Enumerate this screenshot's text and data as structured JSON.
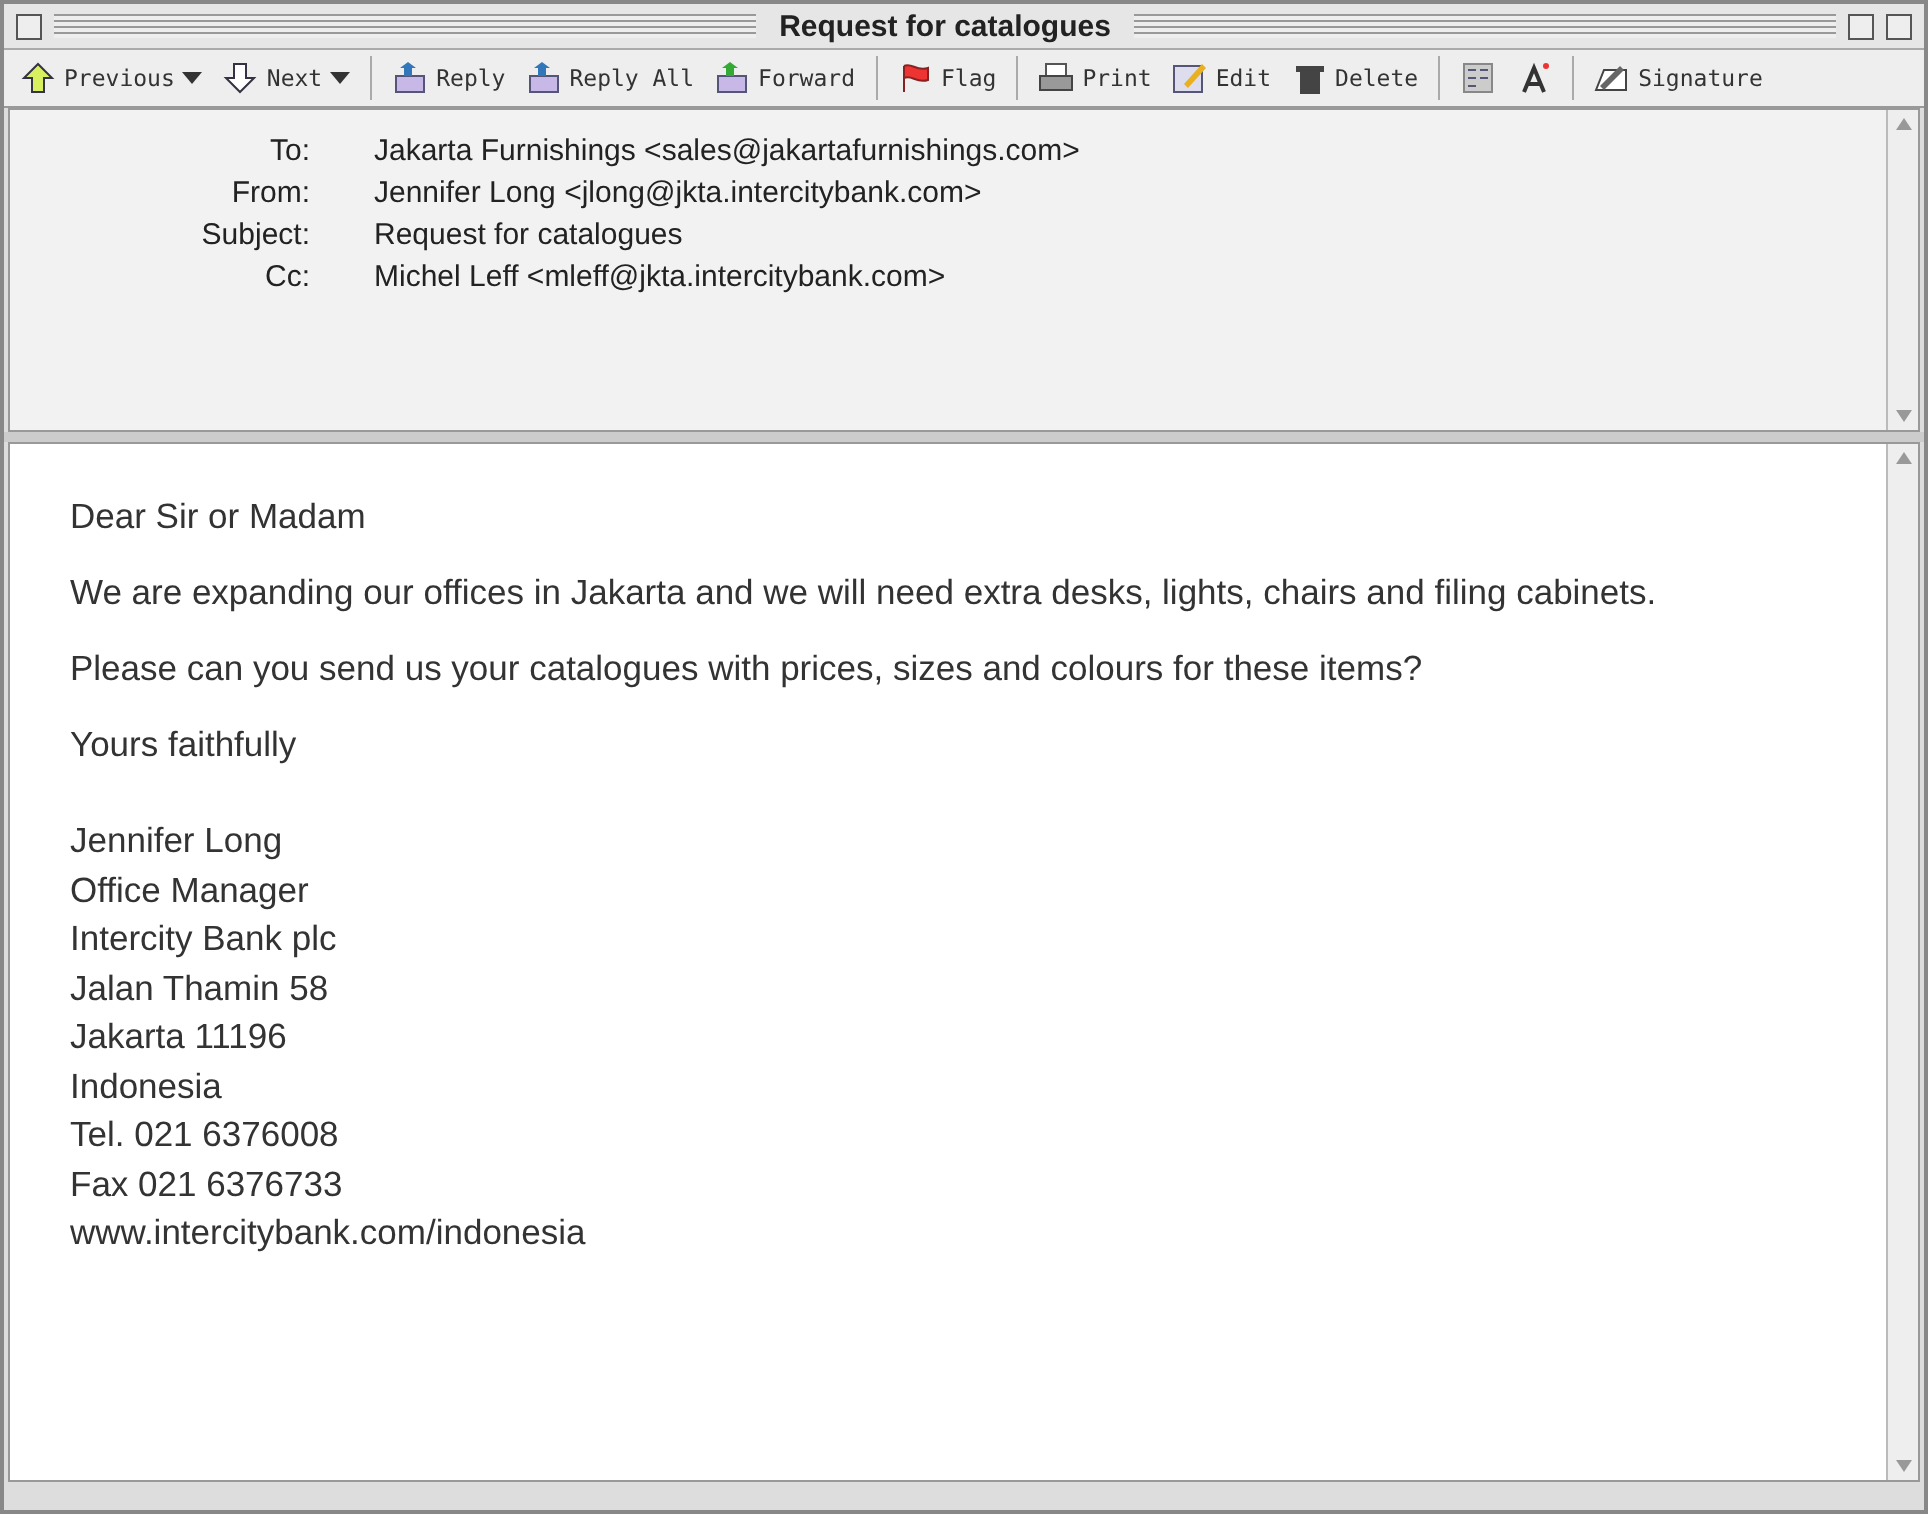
{
  "window": {
    "title": "Request for catalogues"
  },
  "toolbar": [
    [
      {
        "label": "Previous",
        "menu": true
      },
      {
        "label": "Next",
        "menu": true
      }
    ],
    [
      {
        "label": "Reply",
        "menu": false
      },
      {
        "label": "Reply All",
        "menu": false
      },
      {
        "label": "Forward",
        "menu": false
      }
    ],
    [
      {
        "label": "Flag",
        "menu": false
      }
    ],
    [
      {
        "label": "Print",
        "menu": false
      },
      {
        "label": "Edit",
        "menu": false
      },
      {
        "label": "Delete",
        "menu": false
      }
    ],
    [
      {
        "menu": false
      },
      {
        "menu": false
      }
    ],
    [
      {
        "label": "Signature",
        "menu": false
      }
    ]
  ],
  "header": [
    {
      "label": "To:",
      "value": "Jakarta Furnishings <sales@jakartafurnishings.com>"
    },
    {
      "label": "From:",
      "value": "Jennifer Long <jlong@jkta.intercitybank.com>"
    },
    {
      "label": "Subject:",
      "value": "Request for catalogues"
    },
    {
      "label": "Cc:",
      "value": "Michel Leff <mleff@jkta.intercitybank.com>"
    }
  ],
  "body": {
    "paragraphs": [
      "Dear Sir or Madam",
      "We are expanding our offices in Jakarta and we will need extra desks, lights, chairs and filing cabinets.",
      "Please can you send us your catalogues with prices, sizes and colours for these items?",
      "Yours faithfully"
    ],
    "signature": [
      "Jennifer Long",
      "Office Manager",
      "Intercity Bank plc",
      "Jalan Thamin 58",
      "Jakarta 11196",
      "Indonesia",
      "Tel. 021 6376008",
      "Fax 021 6376733",
      "www.intercitybank.com/indonesia"
    ]
  }
}
